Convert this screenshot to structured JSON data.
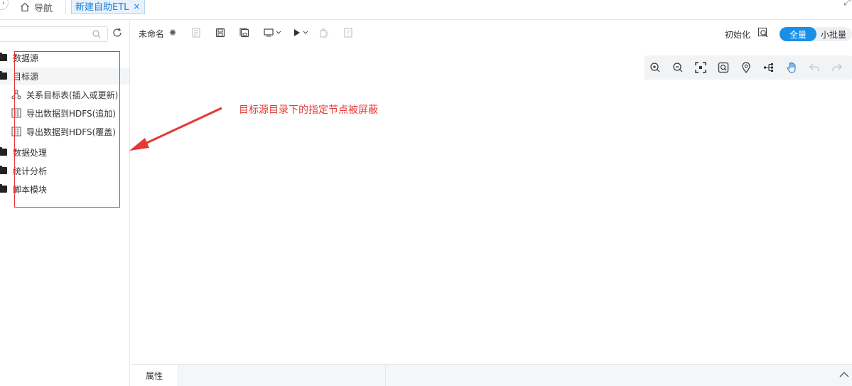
{
  "tabs": {
    "nav_label": "导航",
    "active_label": "新建自助ETL",
    "close_glyph": "×"
  },
  "sidebar": {
    "search_placeholder": "",
    "items": [
      {
        "label": "数据源",
        "type": "folder"
      },
      {
        "label": "目标源",
        "type": "folder",
        "selected": true
      },
      {
        "label": "关系目标表(插入或更新)",
        "type": "child",
        "icon": "relation-icon"
      },
      {
        "label": "导出数据到HDFS(追加)",
        "type": "child",
        "icon": "hdfs-icon"
      },
      {
        "label": "导出数据到HDFS(覆盖)",
        "type": "child",
        "icon": "hdfs-icon"
      },
      {
        "label": "数据处理",
        "type": "folder"
      },
      {
        "label": "统计分析",
        "type": "folder"
      },
      {
        "label": "脚本模块",
        "type": "folder"
      }
    ]
  },
  "toolbar": {
    "title": "未命名",
    "init_label": "初始化",
    "mode_full": "全量",
    "mode_small": "小批量"
  },
  "annotation": {
    "text": "目标源目录下的指定节点被屏蔽",
    "color": "#e53935"
  },
  "bottom": {
    "properties_tab": "属性"
  },
  "colors": {
    "accent": "#1b8ee8",
    "annotation_red": "#e53935"
  }
}
